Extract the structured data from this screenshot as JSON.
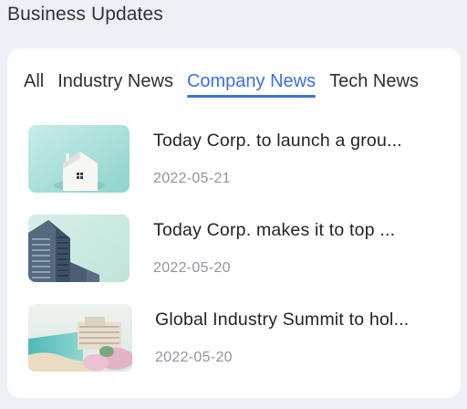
{
  "section": {
    "title": "Business Updates"
  },
  "tabs": [
    {
      "label": "All",
      "active": false
    },
    {
      "label": "Industry News",
      "active": false
    },
    {
      "label": "Company News",
      "active": true
    },
    {
      "label": "Tech News",
      "active": false
    }
  ],
  "news": [
    {
      "title": "Today Corp. to launch a grou...",
      "date": "2022-05-21",
      "thumbnail": "house-icon"
    },
    {
      "title": "Today Corp. makes it to top ...",
      "date": "2022-05-20",
      "thumbnail": "office-building-photo"
    },
    {
      "title": "Global Industry Summit to hol...",
      "date": "2022-05-20",
      "thumbnail": "beach-resort-photo"
    }
  ],
  "colors": {
    "page_background": "#edf1f5",
    "card_background": "#ffffff",
    "accent": "#3f6fdc",
    "title_text": "#1f2329",
    "date_text": "#8e959e"
  }
}
